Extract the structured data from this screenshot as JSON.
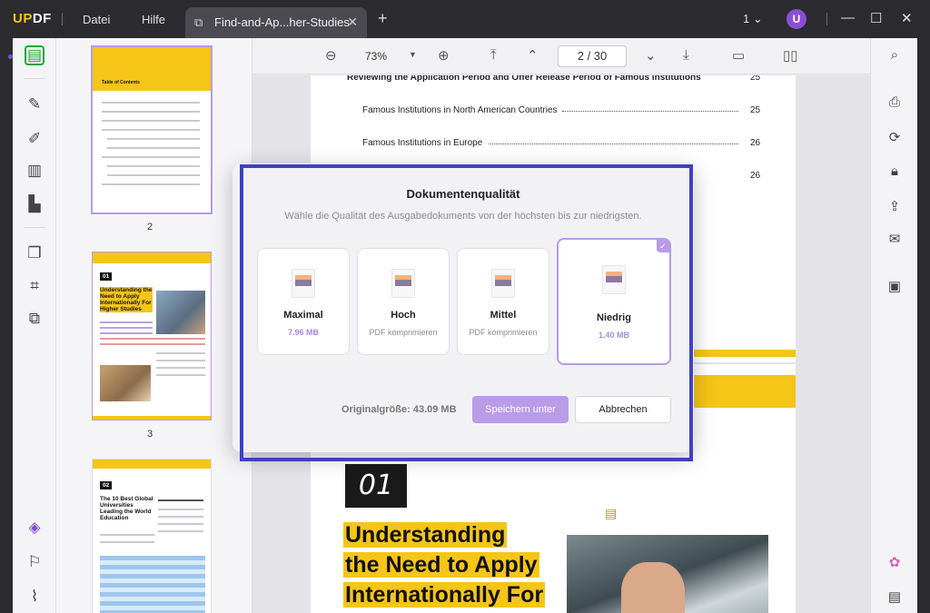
{
  "titlebar": {
    "logo": "UPDF",
    "menu": [
      "Datei",
      "Hilfe"
    ],
    "tab_label": "Find-and-Ap...her-Studies",
    "window_count": "1",
    "avatar_letter": "U"
  },
  "toolbar": {
    "zoom": "73%",
    "page_input": "2  /  30"
  },
  "thumbnails": {
    "page2": {
      "number": "2",
      "heading": "Table of Contents"
    },
    "page3": {
      "number": "3",
      "badge": "01",
      "heading": "Understanding the Need to Apply Internationally For Higher Studies"
    },
    "page4": {
      "badge": "02",
      "heading": "The 10 Best Global Universities Leading the World Education"
    }
  },
  "document": {
    "toc": [
      {
        "text": "Reviewing the Application Period and Offer Release Period of Famous Institutions",
        "page": "25"
      },
      {
        "text": "Famous Institutions in North American Countries",
        "page": "25"
      },
      {
        "text": "Famous Institutions in Europe",
        "page": "26"
      },
      {
        "text": "",
        "page": "26"
      }
    ],
    "section_number": "01",
    "headline_lines": [
      "Understanding",
      "the Need to Apply",
      "Internationally For"
    ]
  },
  "dialog": {
    "title": "Dokumentenqualität",
    "subtitle": "Wähle die Qualität des Ausgabedokuments von der höchsten bis zur niedrigsten.",
    "options": [
      {
        "name": "Maximal",
        "detail": "7.96 MB"
      },
      {
        "name": "Hoch",
        "detail": "PDF komprimieren"
      },
      {
        "name": "Mittel",
        "detail": "PDF komprimieren"
      },
      {
        "name": "Niedrig",
        "detail": "1.40 MB"
      }
    ],
    "selected": "Niedrig",
    "original_size": "Originalgröße: 43.09 MB",
    "save_label": "Speichern unter",
    "cancel_label": "Abbrechen"
  },
  "colors": {
    "accent": "#b99be8",
    "highlight": "#f5c518",
    "titlebar": "#2b2b30",
    "frame": "#3f3fc7"
  }
}
